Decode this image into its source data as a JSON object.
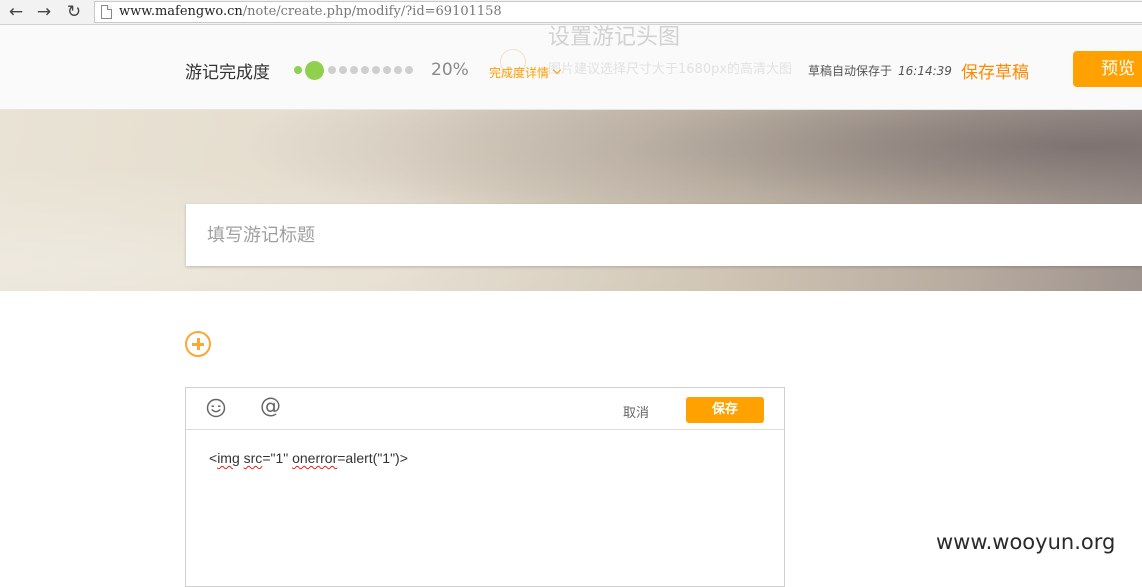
{
  "browser": {
    "back_icon": "arrow-left-icon",
    "forward_icon": "arrow-right-icon",
    "reload_icon": "reload-icon",
    "url_host": "www.mafengwo.cn",
    "url_path": "/note/create.php/modify/?id=69101158"
  },
  "header": {
    "progress_label": "游记完成度",
    "progress_percent": "20%",
    "progress_fraction": 0.2,
    "progress_steps": {
      "done": 1,
      "current": 1,
      "remaining": 8
    },
    "detail_link": "完成度详情",
    "autosave_label": "草稿自动保存于",
    "autosave_time": "16:14:39",
    "save_draft": "保存草稿",
    "preview": "预览",
    "ghost_title": "设置游记头图",
    "ghost_line": "图片建议选择尺寸大于1680px的高清大图"
  },
  "hero": {
    "title_placeholder": "填写游记标题"
  },
  "editor": {
    "emoji_icon": "smiley-icon",
    "at_icon": "at-sign-icon",
    "cancel": "取消",
    "save": "保存",
    "content_parts": {
      "p1": "<",
      "p2": "img",
      "p3": " ",
      "p4": "src",
      "p5": "=\"1\" ",
      "p6": "onerror",
      "p7": "=alert(\"1\")>"
    }
  },
  "watermark": "www.wooyun.org",
  "colors": {
    "accent": "#ffa100",
    "accent_text": "#ff8a00",
    "progress_green": "#8fd14f"
  }
}
